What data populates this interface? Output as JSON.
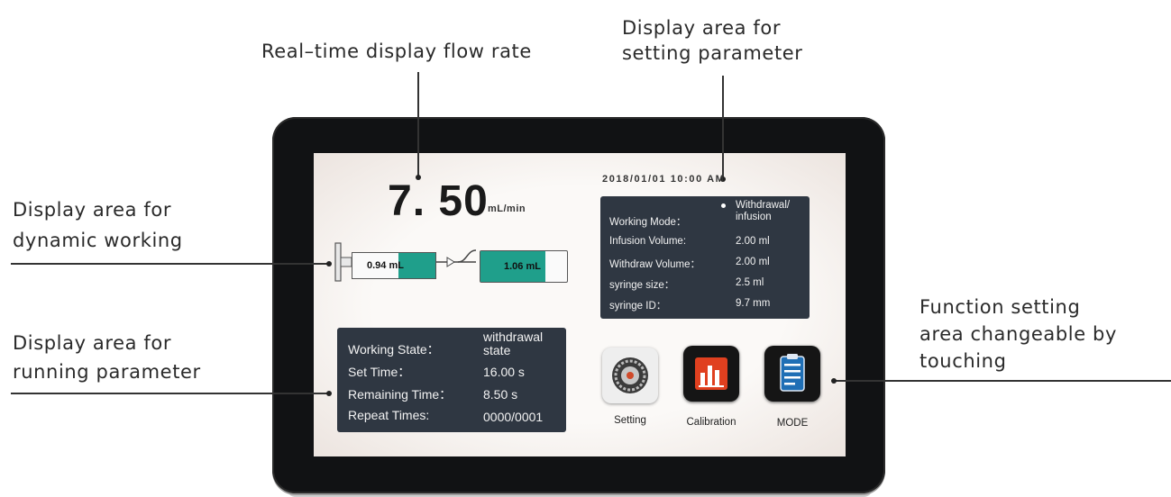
{
  "callouts": {
    "flow_rate": "Real–time display flow rate",
    "setting_param_line1": "Display area for",
    "setting_param_line2": "setting parameter",
    "dynamic_line1": "Display area for",
    "dynamic_line2": "dynamic working",
    "running_line1": "Display area for",
    "running_line2": "running parameter",
    "function_line1": "Function setting",
    "function_line2": "area changeable by",
    "function_line3": "touching"
  },
  "screen": {
    "flow_value": "7. 50",
    "flow_unit": "mL/min",
    "datetime": "2018/01/01  10:00 AM",
    "syringe_left_value": "0.94 mL",
    "syringe_right_value": "1.06 mL",
    "syringe_left_fill": 0.45,
    "syringe_right_fill": 0.75
  },
  "setting_panel": {
    "working_mode_label": "Working Mode：",
    "working_mode_value_line1": "Withdrawal/",
    "working_mode_value_line2": "infusion",
    "infusion_volume_label": "Infusion Volume:",
    "infusion_volume_value": "2.00  ml",
    "withdraw_volume_label": "Withdraw Volume：",
    "withdraw_volume_value": "2.00  ml",
    "syringe_size_label": "syringe size：",
    "syringe_size_value": "2.5   ml",
    "syringe_id_label": "syringe ID：",
    "syringe_id_value": "9.7   mm"
  },
  "running_panel": {
    "working_state_label": "Working State：",
    "working_state_value_line1": "withdrawal",
    "working_state_value_line2": "state",
    "set_time_label": "Set Time：",
    "set_time_value": "16.00  s",
    "remaining_time_label": "Remaining Time：",
    "remaining_time_value": "8.50   s",
    "repeat_times_label": "Repeat Times:",
    "repeat_times_value": "0000/0001"
  },
  "functions": {
    "setting_label": "Setting",
    "calibration_label": "Calibration",
    "mode_label": "MODE",
    "calibration_color": "#e0401f",
    "mode_color": "#1f6fb5"
  }
}
